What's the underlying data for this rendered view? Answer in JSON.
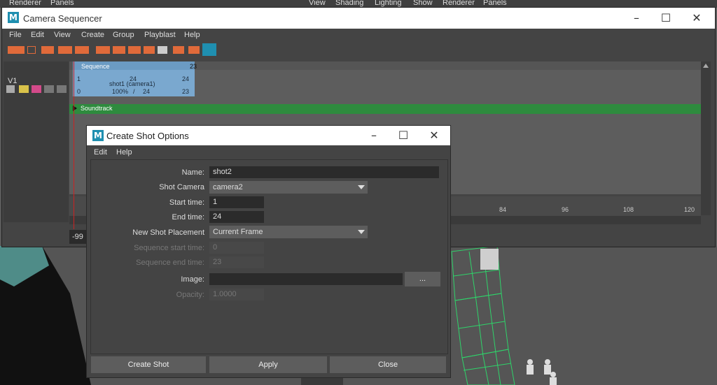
{
  "topbar": {
    "items": [
      "Renderer",
      "Panels",
      "View",
      "Shading",
      "Lighting",
      "Show",
      "Renderer",
      "Panels"
    ]
  },
  "sequencer": {
    "title": "Camera Sequencer",
    "logo": "M",
    "menu": [
      "File",
      "Edit",
      "View",
      "Create",
      "Group",
      "Playblast",
      "Help"
    ],
    "track_label": "V1",
    "sequence_label": "Sequence",
    "sequence_end": "23",
    "shot": {
      "name": "shot1 (camera1)",
      "start": "1",
      "mid_top": "24",
      "end_top": "24",
      "zero": "0",
      "scale": "100%",
      "slash": "/",
      "dur": "24",
      "end": "23"
    },
    "soundtrack_label": "Soundtrack",
    "ruler": [
      "84",
      "96",
      "108",
      "120"
    ],
    "range_start": "-99"
  },
  "dialog": {
    "title": "Create Shot Options",
    "logo": "M",
    "menu": [
      "Edit",
      "Help"
    ],
    "name_label": "Name:",
    "name_value": "shot2",
    "shot_camera_label": "Shot Camera",
    "shot_camera_value": "camera2",
    "start_label": "Start time:",
    "start_value": "1",
    "end_label": "End time:",
    "end_value": "24",
    "placement_label": "New Shot Placement",
    "placement_value": "Current Frame",
    "seq_start_label": "Sequence start time:",
    "seq_start_value": "0",
    "seq_end_label": "Sequence end time:",
    "seq_end_value": "23",
    "image_label": "Image:",
    "image_value": "",
    "browse_label": "...",
    "opacity_label": "Opacity:",
    "opacity_value": "1.0000",
    "buttons": {
      "create": "Create Shot",
      "apply": "Apply",
      "close": "Close"
    }
  },
  "colors": {
    "accent": "#1f8fb0",
    "shot": "#6b9bc3",
    "soundtrack": "#2e8b3e",
    "playhead": "#cc2222",
    "tool_orange": "#e06a3a"
  }
}
